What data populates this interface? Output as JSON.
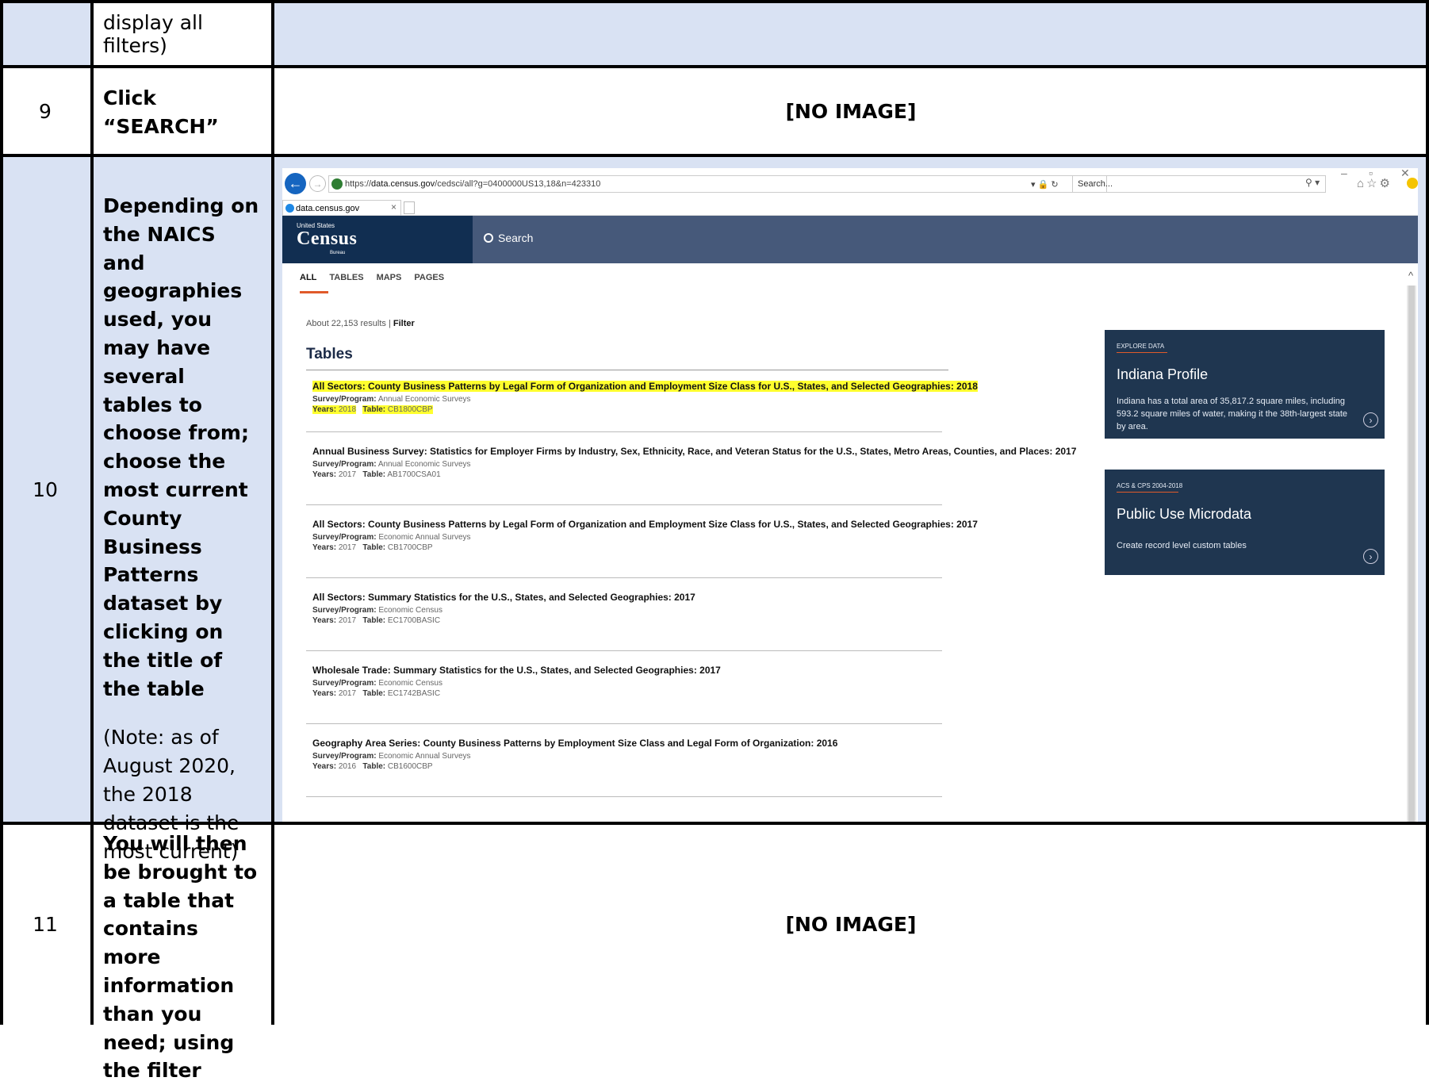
{
  "row_top": {
    "instruction": "display all filters)"
  },
  "row_9": {
    "number": "9",
    "instruction": "Click “SEARCH”",
    "image_placeholder": "[NO IMAGE]"
  },
  "row_10": {
    "number": "10",
    "instruction": "Depending on the NAICS and geographies used, you may have several tables to choose from; choose the most current County Business Patterns dataset by clicking on the title of the table",
    "note": "(Note: as of August 2020, the 2018 dataset is the most current)"
  },
  "row_11": {
    "number": "11",
    "instruction": "You will then be brought to a table that contains more information than you need; using the filter",
    "image_placeholder": "[NO IMAGE]"
  },
  "browser": {
    "url_prefix": "https://",
    "url_host": "data.census.gov",
    "url_path": "/cedsci/all?g=0400000US13,18&n=423310",
    "url_icons": "▾ 🔒 ↻",
    "search_placeholder": "Search...",
    "search_glass": "⚲ ▾",
    "window_min": "–",
    "window_restore": "▫",
    "window_close": "✕",
    "toolbar_icons": "⌂☆⚙",
    "tab_title": "data.census.gov",
    "tab_close": "×",
    "back_glyph": "←",
    "forward_glyph": "→",
    "scroll_up": "^"
  },
  "census": {
    "logo_small": "United States",
    "logo": "Census",
    "logo_bureau": "Bureau",
    "search_label": "Search",
    "tabs": [
      "ALL",
      "TABLES",
      "MAPS",
      "PAGES"
    ],
    "results_count": "About 22,153 results | ",
    "filter_label": "Filter",
    "tables_heading": "Tables",
    "results": [
      {
        "title": "All Sectors: County Business Patterns  by Legal Form of Organization and Employment Size Class for U.S., States, and Selected Geographies: 2018",
        "survey_label": "Survey/Program:",
        "survey": "Annual Economic Surveys",
        "years_label": "Years:",
        "years": "2018",
        "table_label": "Table:",
        "table": "CB1800CBP",
        "highlighted": true
      },
      {
        "title": "Annual Business Survey: Statistics for Employer Firms by Industry, Sex, Ethnicity, Race, and Veteran Status for the U.S., States, Metro Areas, Counties, and Places: 2017",
        "survey_label": "Survey/Program:",
        "survey": "Annual Economic Surveys",
        "years_label": "Years:",
        "years": "2017",
        "table_label": "Table:",
        "table": "AB1700CSA01",
        "highlighted": false
      },
      {
        "title": "All Sectors: County Business Patterns  by Legal Form of Organization and Employment Size Class for U.S., States, and Selected Geographies: 2017",
        "survey_label": "Survey/Program:",
        "survey": "Economic Annual Surveys",
        "years_label": "Years:",
        "years": "2017",
        "table_label": "Table:",
        "table": "CB1700CBP",
        "highlighted": false
      },
      {
        "title": "All Sectors: Summary Statistics for the U.S., States, and Selected Geographies: 2017",
        "survey_label": "Survey/Program:",
        "survey": "Economic Census",
        "years_label": "Years:",
        "years": "2017",
        "table_label": "Table:",
        "table": "EC1700BASIC",
        "highlighted": false
      },
      {
        "title": "Wholesale Trade: Summary Statistics for the U.S., States, and Selected Geographies: 2017",
        "survey_label": "Survey/Program:",
        "survey": "Economic Census",
        "years_label": "Years:",
        "years": "2017",
        "table_label": "Table:",
        "table": "EC1742BASIC",
        "highlighted": false
      },
      {
        "title": "Geography Area Series: County Business Patterns by Employment Size Class and Legal Form of Organization: 2016",
        "survey_label": "Survey/Program:",
        "survey": "Economic Annual Surveys",
        "years_label": "Years:",
        "years": "2016",
        "table_label": "Table:",
        "table": "CB1600CBP",
        "highlighted": false
      }
    ],
    "cards": [
      {
        "eyebrow": "EXPLORE DATA",
        "title": "Indiana Profile",
        "desc": "Indiana has a total area of 35,817.2 square miles, including 593.2 square miles of water, making it the 38th-largest state by area.",
        "arrow": "›"
      },
      {
        "eyebrow": "ACS & CPS 2004-2018",
        "title": "Public Use Microdata",
        "desc": "Create record level custom tables",
        "arrow": "›"
      }
    ],
    "highlight_color": "#ffff2e",
    "accent_color": "#e05a2a",
    "header_color": "#46597a"
  }
}
